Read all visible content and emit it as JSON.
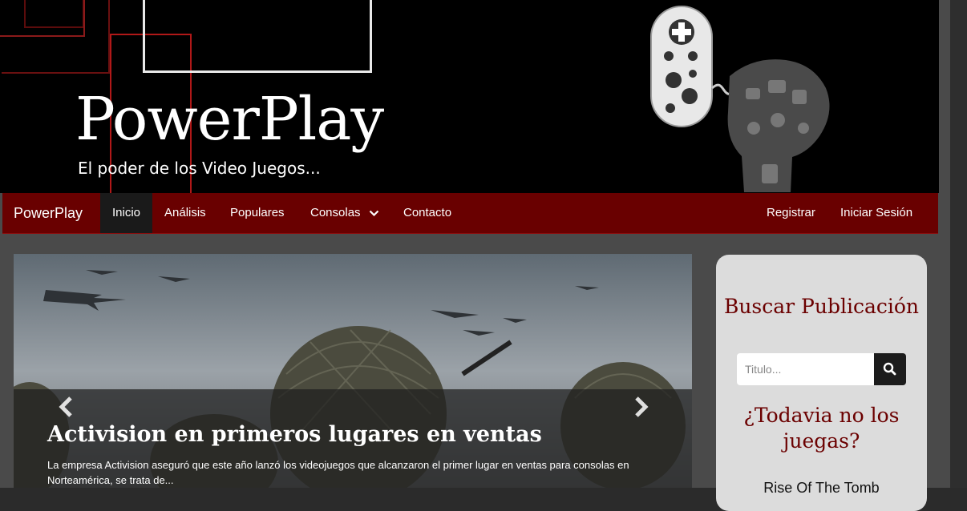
{
  "banner": {
    "logo_title": "PowerPlay",
    "logo_subtitle": "El poder de los Video Juegos..."
  },
  "navbar": {
    "brand": "PowerPlay",
    "items": [
      {
        "label": "Inicio",
        "active": true
      },
      {
        "label": "Análisis"
      },
      {
        "label": "Populares"
      },
      {
        "label": "Consolas",
        "dropdown": true
      },
      {
        "label": "Contacto"
      }
    ],
    "right_items": [
      {
        "label": "Registrar"
      },
      {
        "label": "Iniciar Sesión"
      }
    ]
  },
  "carousel": {
    "slide_title": "Activision en primeros lugares en ventas",
    "slide_description": "La empresa Activision aseguró que este año lanzó los videojuegos que alcanzaron el primer lugar en ventas para consolas en Norteamérica, se trata de..."
  },
  "sidebar": {
    "search_heading": "Buscar Publicación",
    "search_placeholder": "Titulo...",
    "promo_heading": "¿Todavia no los juegas?",
    "first_item": "Rise Of The Tomb"
  },
  "colors": {
    "nav_bg": "#690000",
    "accent": "#6b0000",
    "banner_bg": "#000000"
  },
  "icons": [
    "search-icon",
    "chevron-down-icon",
    "chevron-left-icon",
    "chevron-right-icon"
  ]
}
